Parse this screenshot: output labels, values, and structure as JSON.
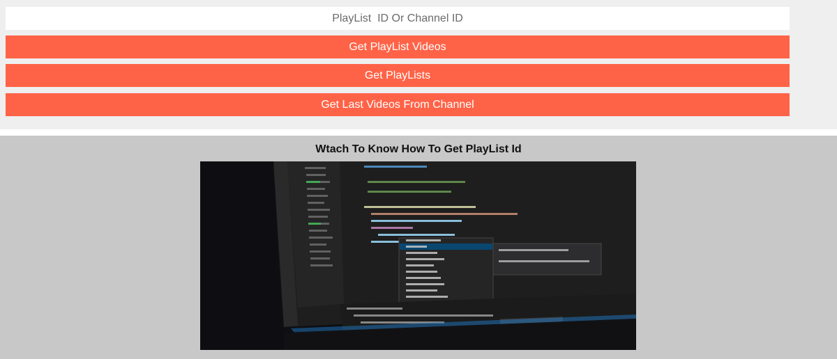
{
  "search": {
    "placeholder": "PlayList  ID Or Channel ID",
    "value": ""
  },
  "buttons": {
    "get_playlist_videos": "Get PlayList Videos",
    "get_playlists": "Get PlayLists",
    "get_last_videos": "Get Last Videos From Channel"
  },
  "video": {
    "title": "Wtach To Know How To Get PlayList Id"
  },
  "colors": {
    "accent": "#ff6347",
    "page_background": "#efefef",
    "video_section_background": "#c8c8c8"
  }
}
